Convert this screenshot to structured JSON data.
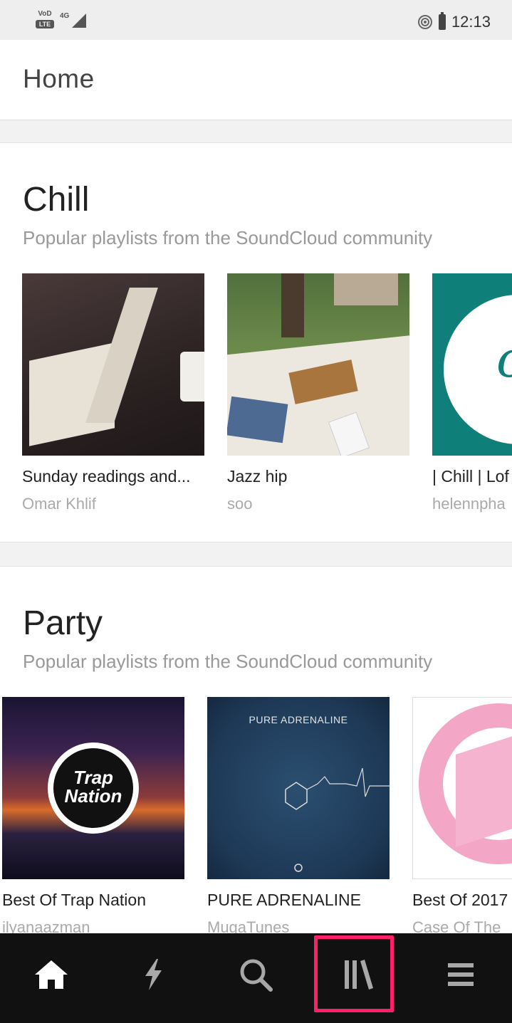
{
  "status_bar": {
    "volte_label": "VoD",
    "lte_label": "LTE",
    "network_label": "4G",
    "time": "12:13"
  },
  "header": {
    "title": "Home"
  },
  "sections": [
    {
      "title": "Chill",
      "subtitle": "Popular playlists from the SoundCloud community",
      "cards": [
        {
          "title": "Sunday readings and...",
          "author": "Omar Khlif"
        },
        {
          "title": "Jazz hip",
          "author": "soo"
        },
        {
          "title": "| Chill | Lof",
          "author": "helennpha"
        }
      ]
    },
    {
      "title": "Party",
      "subtitle": "Popular playlists from the SoundCloud community",
      "cards": [
        {
          "title": "Best Of Trap Nation",
          "author": "ilyanaazman",
          "art_text": "Trap Nation"
        },
        {
          "title": "PURE ADRENALINE",
          "author": "MugaTunes",
          "art_text": "PURE ADRENALINE"
        },
        {
          "title": "Best Of 2017",
          "author": "Case Of The"
        }
      ]
    }
  ],
  "chill_art_letter": "c",
  "bottom_nav": {
    "items": [
      {
        "icon": "home-icon",
        "active": true
      },
      {
        "icon": "lightning-icon",
        "active": false
      },
      {
        "icon": "search-icon",
        "active": false
      },
      {
        "icon": "library-icon",
        "active": false
      },
      {
        "icon": "menu-icon",
        "active": false
      }
    ],
    "highlight_color": "#ff1f6b"
  }
}
